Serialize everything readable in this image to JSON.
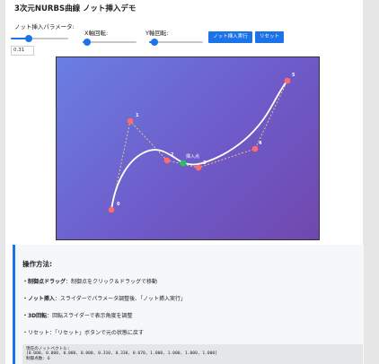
{
  "title": "3次元NURBS曲線 ノット挿入デモ",
  "controls": {
    "knot_param_label": "ノット挿入パラメータ:",
    "knot_param_value": "0.31",
    "knot_param_fraction": 0.31,
    "x_rotation_label": "X軸回転:",
    "x_rotation_fraction": 0.08,
    "y_rotation_label": "Y軸回転:",
    "y_rotation_fraction": 0.1,
    "insert_button": "ノット挿入実行",
    "reset_button": "リセット"
  },
  "canvas": {
    "insert_point_label": "挿入点",
    "control_point_labels": [
      "0",
      "1",
      "2",
      "3",
      "4",
      "5"
    ],
    "colors": {
      "curve": "#ffffff",
      "control_point": "#ff6b6b",
      "control_polygon": "#ffcc66",
      "insert_point": "#22c55e"
    }
  },
  "instructions": {
    "heading": "操作方法:",
    "items": [
      {
        "bold": "・制御点ドラッグ",
        "text": "：制御点をクリック＆ドラッグで移動"
      },
      {
        "bold": "・ノット挿入",
        "text": "：スライダーでパラメータ調整後、「ノット挿入実行」"
      },
      {
        "bold": "・3D回転",
        "text": "：回転スライダーで表示角度を調整"
      },
      {
        "bold": "",
        "text": "・リセット：「リセット」ボタンで元の状態に戻す"
      }
    ]
  },
  "info": {
    "knot_vector_label": "現在のノットベクトル:",
    "knot_vector": "[0.000, 0.000, 0.000, 0.000, 0.310, 0.330, 0.670, 1.000, 1.000, 1.000, 1.000]",
    "control_point_count": "制御点数: 6"
  }
}
